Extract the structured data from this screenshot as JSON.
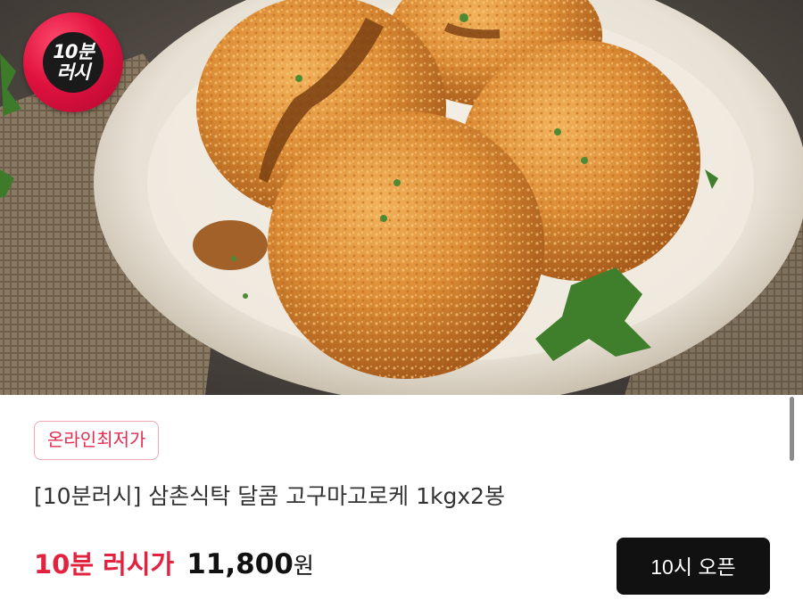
{
  "product_image": {
    "alt": "고구마고로케"
  },
  "badge": {
    "line1": "10분",
    "line2": "러시"
  },
  "tag": {
    "label": "온라인최저가"
  },
  "product": {
    "title": "[10분러시] 삼촌식탁 달콤 고구마고로케 1kgx2봉"
  },
  "price": {
    "label": "10분 러시가",
    "amount": "11,800",
    "unit": "원"
  },
  "action": {
    "button_label": "10시 오픈"
  },
  "colors": {
    "accent": "#e2233f",
    "tag_border": "#f1a8b3",
    "button_bg": "#111111"
  }
}
